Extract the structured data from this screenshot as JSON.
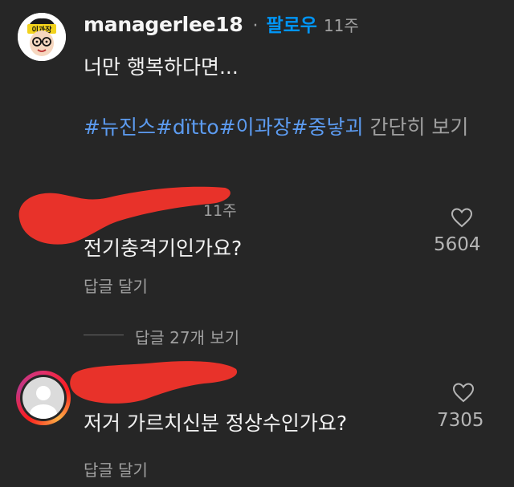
{
  "post": {
    "username": "managerlee18",
    "separator": "·",
    "follow_label": "팔로우",
    "time": "11주",
    "caption": "너만 행복하다면...",
    "hashtags": [
      "#뉴진스",
      "#dïtto",
      "#이과장",
      "#중낳괴"
    ],
    "more_label": "간단히 보기",
    "avatar_logo_text": "이과장"
  },
  "comments": [
    {
      "time": "11주",
      "text": "전기충격기인가요?",
      "likes": "5604",
      "reply_label": "답글 달기",
      "view_replies_label": "답글 27개 보기"
    },
    {
      "text": "저거 가르치신분 정상수인가요?",
      "likes": "7305",
      "reply_label": "답글 달기"
    }
  ],
  "colors": {
    "background": "#262626",
    "follow_blue": "#0095f6",
    "hashtag_blue": "#5c9bf0",
    "redaction_red": "#e8322a",
    "secondary_text": "#a0a0a0"
  },
  "icons": [
    "heart-icon",
    "default-avatar-icon"
  ]
}
